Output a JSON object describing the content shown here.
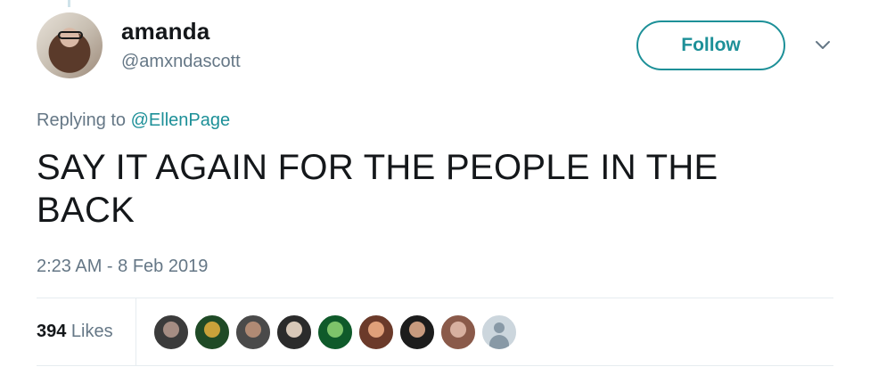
{
  "author": {
    "display_name": "amanda",
    "handle": "@amxndascott"
  },
  "follow_button_label": "Follow",
  "reply_context": {
    "prefix": "Replying to ",
    "mention": "@EllenPage"
  },
  "tweet_text": "SAY IT AGAIN FOR THE PEOPLE IN THE BACK",
  "timestamp": "2:23 AM - 8 Feb 2019",
  "likes": {
    "count": "394",
    "label": " Likes"
  },
  "likers": [
    {
      "name": "liker-avatar-1",
      "colors": [
        "#3b3b3b",
        "#a58d83"
      ]
    },
    {
      "name": "liker-avatar-2",
      "colors": [
        "#1f4a26",
        "#c9a23a"
      ]
    },
    {
      "name": "liker-avatar-3",
      "colors": [
        "#4a4a4a",
        "#b08a74"
      ]
    },
    {
      "name": "liker-avatar-4",
      "colors": [
        "#2b2b2b",
        "#d8c8b8"
      ]
    },
    {
      "name": "liker-avatar-5",
      "colors": [
        "#0f5a2a",
        "#7ec36a"
      ]
    },
    {
      "name": "liker-avatar-6",
      "colors": [
        "#6b3a2a",
        "#e0a07a"
      ]
    },
    {
      "name": "liker-avatar-7",
      "colors": [
        "#1c1c1c",
        "#c79a7e"
      ]
    },
    {
      "name": "liker-avatar-8",
      "colors": [
        "#8a5a4a",
        "#d8b0a0"
      ]
    },
    {
      "name": "liker-avatar-default",
      "colors": [
        "#ccd6dd",
        "#8899a6"
      ]
    }
  ],
  "colors": {
    "accent": "#1d9098",
    "secondary_text": "#657786",
    "primary_text": "#14171a"
  }
}
